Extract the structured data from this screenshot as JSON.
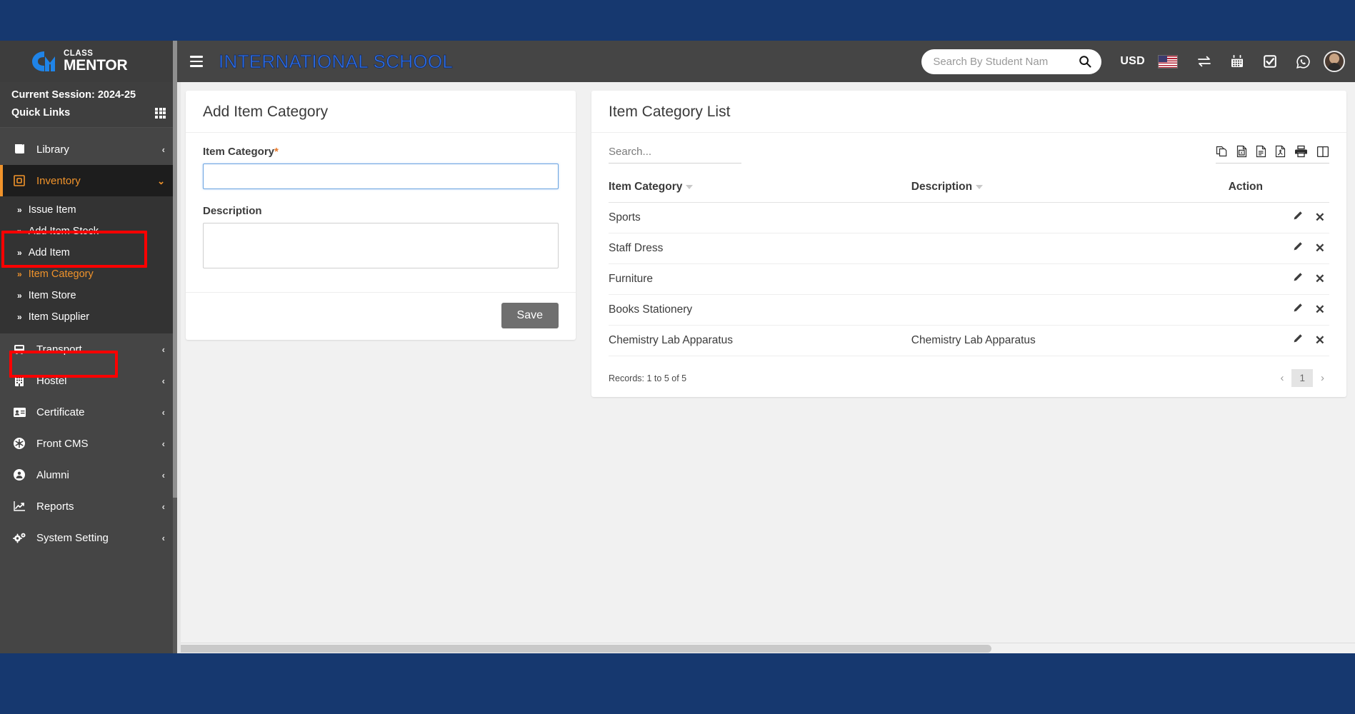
{
  "brand": {
    "logo_top": "CLASS",
    "logo_bottom": "MENTOR",
    "logo_icon": "cm-monogram-icon"
  },
  "sidebar": {
    "session_label": "Current Session: 2024-25",
    "quick_links_label": "Quick Links",
    "quick_links_icon": "grid-icon",
    "items": [
      {
        "label": "Library",
        "icon": "book-icon",
        "caret": "‹",
        "state": "collapsed"
      },
      {
        "label": "Inventory",
        "icon": "box-icon",
        "caret": "⌄",
        "state": "expanded-active"
      },
      {
        "label": "Transport",
        "icon": "bus-icon",
        "caret": "‹",
        "state": "collapsed"
      },
      {
        "label": "Hostel",
        "icon": "building-icon",
        "caret": "‹",
        "state": "collapsed"
      },
      {
        "label": "Certificate",
        "icon": "id-card-icon",
        "caret": "‹",
        "state": "collapsed"
      },
      {
        "label": "Front CMS",
        "icon": "asterisk-icon",
        "caret": "‹",
        "state": "collapsed"
      },
      {
        "label": "Alumni",
        "icon": "user-circle-icon",
        "caret": "‹",
        "state": "collapsed"
      },
      {
        "label": "Reports",
        "icon": "chart-line-icon",
        "caret": "‹",
        "state": "collapsed"
      },
      {
        "label": "System Setting",
        "icon": "gears-icon",
        "caret": "‹",
        "state": "collapsed"
      }
    ],
    "inventory_submenu": [
      {
        "label": "Issue Item",
        "selected": false
      },
      {
        "label": "Add Item Stock",
        "selected": false
      },
      {
        "label": "Add Item",
        "selected": false
      },
      {
        "label": "Item Category",
        "selected": true
      },
      {
        "label": "Item Store",
        "selected": false
      },
      {
        "label": "Item Supplier",
        "selected": false
      }
    ]
  },
  "topbar": {
    "menu_toggle_icon": "hamburger-icon",
    "school_title": "INTERNATIONAL SCHOOL",
    "search_placeholder": "Search By Student Nam",
    "search_value": "",
    "search_icon": "search-icon",
    "currency": "USD",
    "flag_icon": "us-flag-icon",
    "exchange_icon": "exchange-arrows-icon",
    "calendar_icon": "calendar-icon",
    "checkbox_icon": "check-square-icon",
    "whatsapp_icon": "whatsapp-icon",
    "avatar_icon": "user-avatar"
  },
  "form": {
    "title": "Add Item Category",
    "item_category_label": "Item Category",
    "required_mark": "*",
    "item_category_value": "",
    "description_label": "Description",
    "description_value": "",
    "save_label": "Save"
  },
  "list": {
    "title": "Item Category List",
    "search_placeholder": "Search...",
    "search_value": "",
    "export_icons": [
      {
        "name": "copy-icon",
        "title": "Copy"
      },
      {
        "name": "excel-icon",
        "title": "Excel"
      },
      {
        "name": "csv-icon",
        "title": "CSV"
      },
      {
        "name": "pdf-icon",
        "title": "PDF"
      },
      {
        "name": "print-icon",
        "title": "Print"
      },
      {
        "name": "columns-icon",
        "title": "Column visibility"
      }
    ],
    "columns": [
      "Item Category",
      "Description",
      "Action"
    ],
    "rows": [
      {
        "item_category": "Sports",
        "description": ""
      },
      {
        "item_category": "Staff Dress",
        "description": ""
      },
      {
        "item_category": "Furniture",
        "description": ""
      },
      {
        "item_category": "Books Stationery",
        "description": ""
      },
      {
        "item_category": "Chemistry Lab Apparatus",
        "description": "Chemistry Lab Apparatus"
      }
    ],
    "row_actions": {
      "edit_icon": "pencil-icon",
      "delete_icon": "close-x-icon"
    },
    "records_text": "Records: 1 to 5 of 5",
    "pagination": {
      "prev": "‹",
      "current_page": "1",
      "next": "›"
    }
  },
  "colors": {
    "frame_blue": "#16386f",
    "sidebar_dark": "#454545",
    "submenu_dark": "#333333",
    "active_orange": "#f0932b",
    "title_blue": "#2f6fe4",
    "annotation_red": "#ff0000",
    "content_bg": "#f1f1f1",
    "save_gray": "#6f6f6f"
  }
}
